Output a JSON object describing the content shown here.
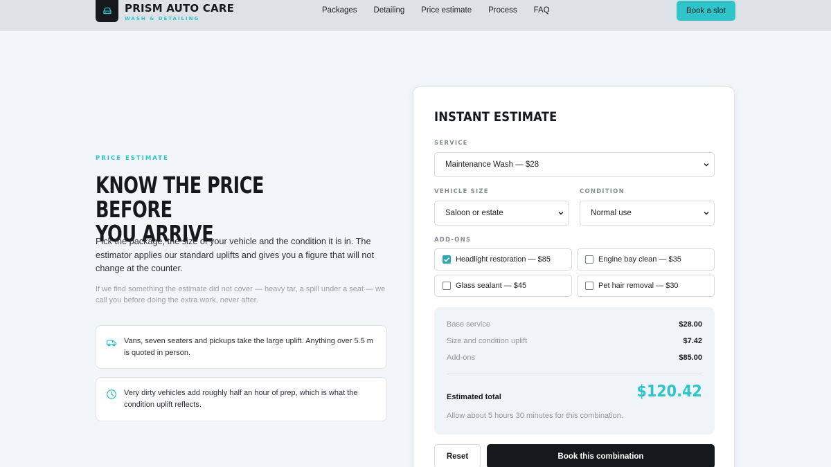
{
  "brand": {
    "name": "PRISM AUTO CARE",
    "tagline": "WASH & DETAILING",
    "logo_icon": "car-icon"
  },
  "nav": {
    "links": [
      "Packages",
      "Detailing",
      "Price estimate",
      "Process",
      "FAQ"
    ],
    "cta": "Book a slot"
  },
  "hero": {
    "eyebrow": "PRICE ESTIMATE",
    "title_line1": "KNOW THE PRICE BEFORE",
    "title_line2": "YOU ARRIVE",
    "description": "Pick the package, the size of your vehicle and the condition it is in. The estimator applies our standard uplifts and gives you a figure that will not change at the counter.",
    "note": "If we find something the estimate did not cover — heavy tar, a spill under a seat — we call you before doing the extra work, never after.",
    "info_cards": [
      {
        "icon": "van-icon",
        "text": "Vans, seven seaters and pickups take the large uplift. Anything over 5.5 m is quoted in person."
      },
      {
        "icon": "clock-icon",
        "text": "Very dirty vehicles add roughly half an hour of prep, which is what the condition uplift reflects."
      }
    ]
  },
  "estimate": {
    "title": "INSTANT ESTIMATE",
    "service_label": "SERVICE",
    "service_value": "Maintenance Wash — $28",
    "vehicle_label": "VEHICLE SIZE",
    "vehicle_value": "Saloon or estate",
    "condition_label": "CONDITION",
    "condition_value": "Normal use",
    "addons_label": "ADD-ONS",
    "addons": [
      {
        "label": "Headlight restoration — $85",
        "checked": true
      },
      {
        "label": "Engine bay clean — $35",
        "checked": false
      },
      {
        "label": "Glass sealant — $45",
        "checked": false
      },
      {
        "label": "Pet hair removal — $30",
        "checked": false
      }
    ],
    "summary": {
      "base_label": "Base service",
      "base_value": "$28.00",
      "uplift_label": "Size and condition uplift",
      "uplift_value": "$7.42",
      "addons_label": "Add-ons",
      "addons_value": "$85.00",
      "total_label": "Estimated total",
      "total_value": "$120.42",
      "time_note": "Allow about 5 hours 30 minutes for this combination."
    },
    "reset_label": "Reset",
    "book_label": "Book this combination"
  },
  "colors": {
    "accent": "#2ec4c9",
    "dark": "#15181c",
    "background": "#f1f6f8"
  }
}
